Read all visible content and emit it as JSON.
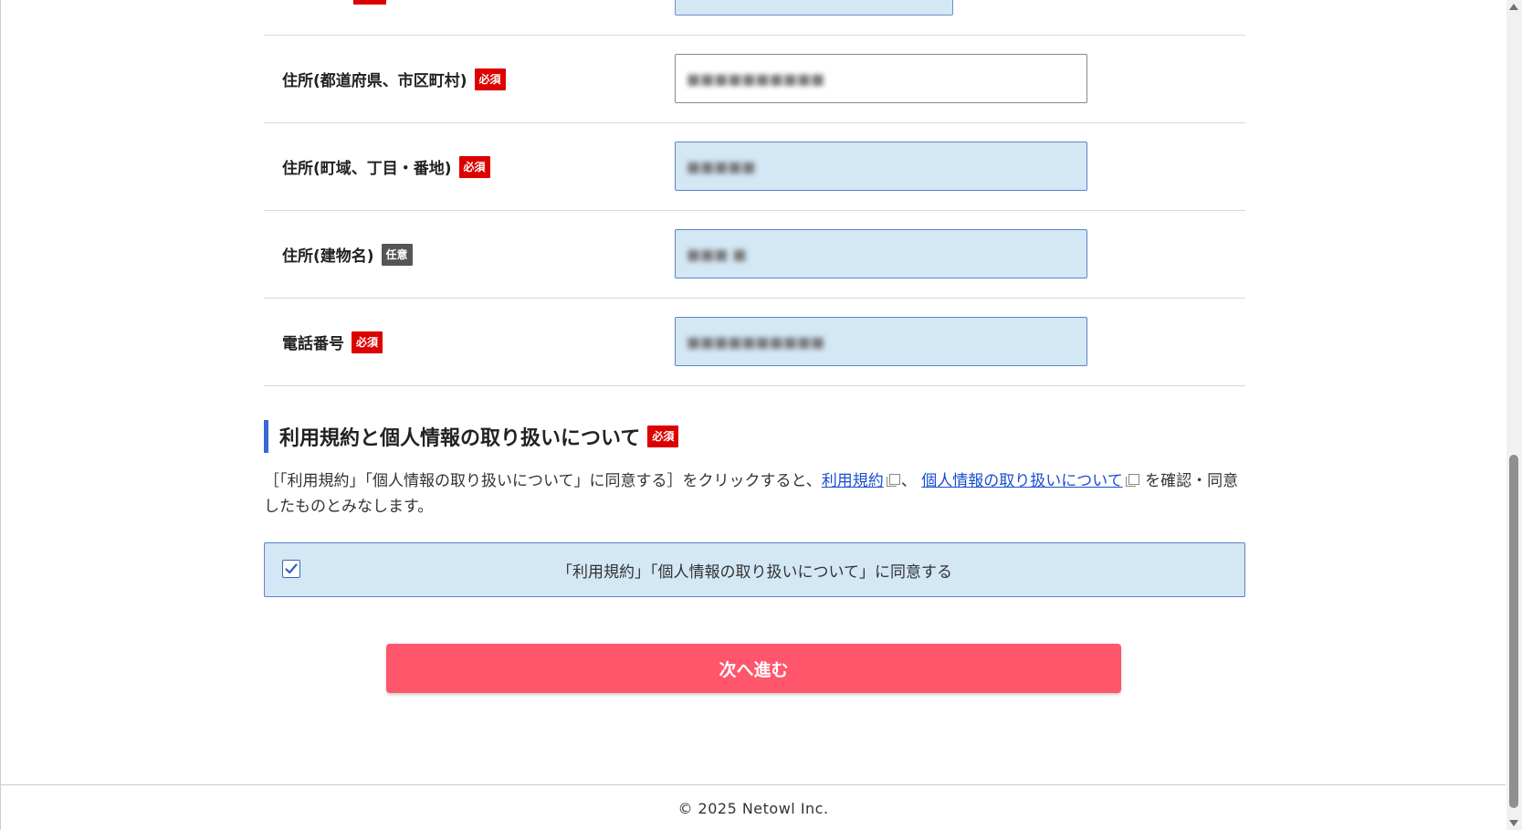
{
  "form": {
    "rows": [
      {
        "label": "住所(都道府県、市区町村)",
        "badge": "必須",
        "value": "■■■■■■■■■■"
      },
      {
        "label": "住所(町域、丁目・番地)",
        "badge": "必須",
        "value": "■■■■■"
      },
      {
        "label": "住所(建物名)",
        "badge": "任意",
        "value": "■■■ ■"
      },
      {
        "label": "電話番号",
        "badge": "必須",
        "value": "■■■■■■■■■■"
      }
    ]
  },
  "terms": {
    "heading": "利用規約と個人情報の取り扱いについて",
    "badge": "必須",
    "desc_prefix": "［「利用規約」「個人情報の取り扱いについて」に同意する］をクリックすると、",
    "link_terms": "利用規約",
    "separator": "、",
    "link_privacy": "個人情報の取り扱いについて",
    "desc_suffix": "を確認・同意したものとみなします。",
    "agree_label": "「利用規約」「個人情報の取り扱いについて」に同意する",
    "agree_checked": true
  },
  "actions": {
    "next_label": "次へ進む"
  },
  "footer": {
    "copyright": "© 2025 Netowl Inc."
  },
  "colors": {
    "required_badge": "#dc0000",
    "optional_badge": "#555555",
    "field_bg": "#d3e7f5",
    "next_button": "#ff566b",
    "heading_accent": "#3869d4"
  }
}
